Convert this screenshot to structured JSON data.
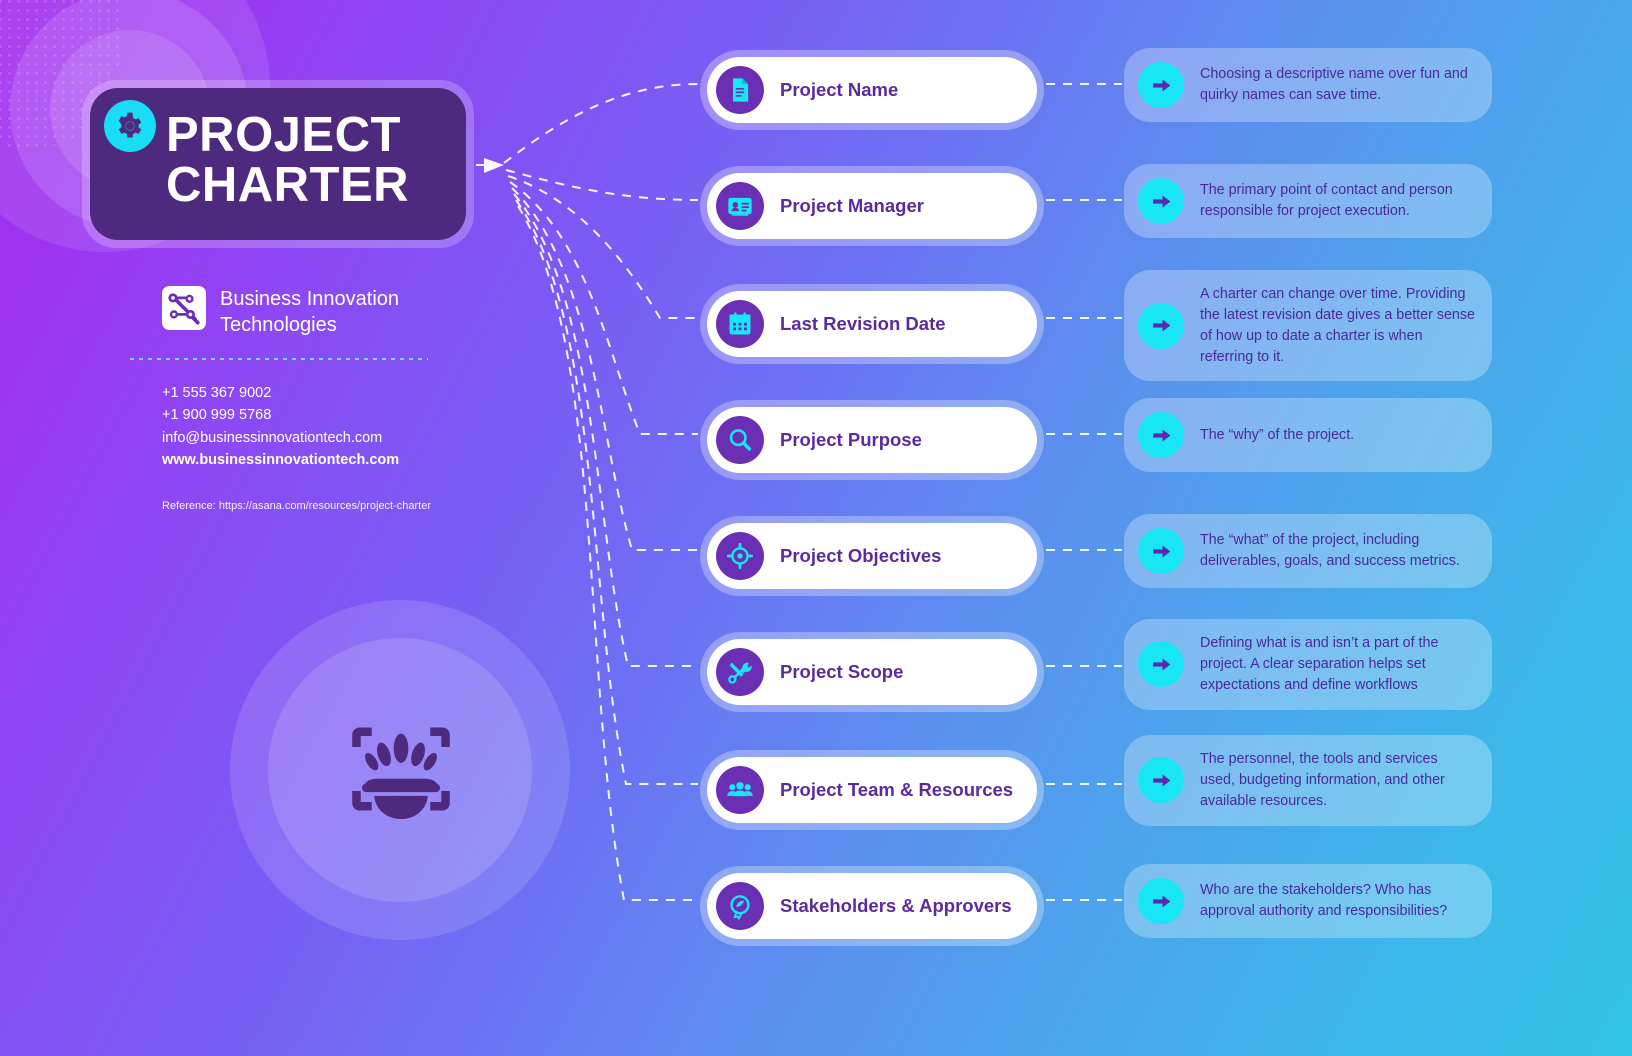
{
  "header": {
    "title_line1": "PROJECT",
    "title_line2": "CHARTER",
    "gear_icon": "gear-icon"
  },
  "company": {
    "logo_icon": "circuit-node-logo-icon",
    "name": "Business Innovation Technologies",
    "phone1": "+1 555 367 9002",
    "phone2": "+1 900 999 5768",
    "email": "info@businessinnovationtech.com",
    "website": "www.businessinnovationtech.com"
  },
  "reference": "Reference: https://asana.com/resources/project-charter",
  "illustration_icon": "idea-burst-scan-icon",
  "colors": {
    "title_card": "#4e2a7e",
    "icon_circle": "#6b2fb5",
    "accent_cyan": "#19e6f5",
    "label_purple": "#5b2a9e",
    "desc_purple": "#4a2a9a",
    "gradient_start": "#a32bf0",
    "gradient_end": "#32c3e8"
  },
  "items": [
    {
      "label": "Project Name",
      "icon": "document-icon",
      "arrow_icon": "arrow-right-icon",
      "description": "Choosing a descriptive name over fun and quirky names can save time."
    },
    {
      "label": "Project Manager",
      "icon": "id-card-icon",
      "arrow_icon": "arrow-right-icon",
      "description": "The primary point of contact and person responsible for project execution."
    },
    {
      "label": "Last Revision Date",
      "icon": "calendar-icon",
      "arrow_icon": "arrow-right-icon",
      "description": "A charter can change over  time. Providing the latest revision date gives a better sense of how up to date a charter is when referring to it."
    },
    {
      "label": "Project Purpose",
      "icon": "magnifier-icon",
      "arrow_icon": "arrow-right-icon",
      "description": "The “why” of the project."
    },
    {
      "label": "Project Objectives",
      "icon": "target-crosshair-icon",
      "arrow_icon": "arrow-right-icon",
      "description": "The “what” of the project, including deliverables, goals, and success metrics."
    },
    {
      "label": "Project Scope",
      "icon": "tools-wrench-screwdriver-icon",
      "arrow_icon": "arrow-right-icon",
      "description": "Defining what is and isn’t a part of the project. A clear separation helps set expectations and define workflows"
    },
    {
      "label": "Project Team & Resources",
      "icon": "people-group-icon",
      "arrow_icon": "arrow-right-icon",
      "description": "The personnel, the tools and services used, budgeting information, and other available resources."
    },
    {
      "label": "Stakeholders & Approvers",
      "icon": "badge-ribbon-icon",
      "arrow_icon": "arrow-right-icon",
      "description": "Who are the stakeholders? Who has approval authority and responsibilities?"
    }
  ]
}
